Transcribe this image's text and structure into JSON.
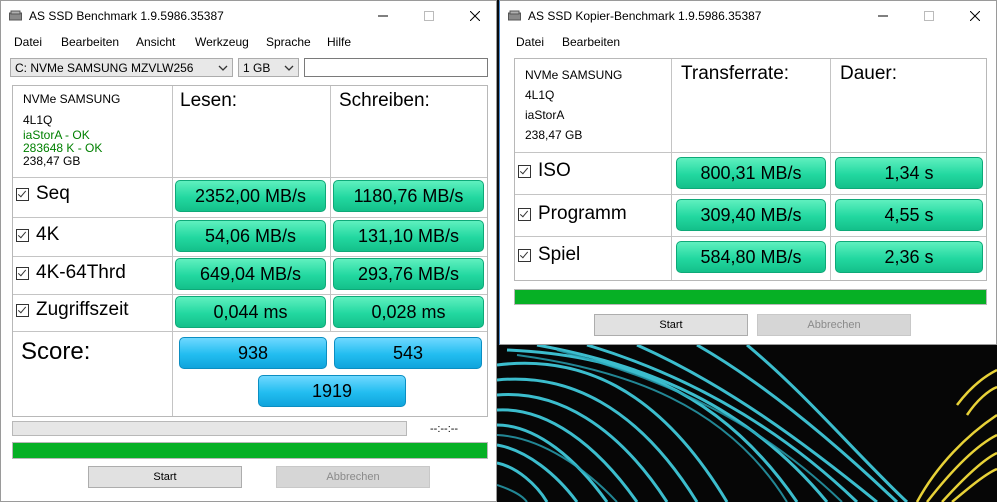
{
  "win1": {
    "title": "AS SSD Benchmark 1.9.5986.35387",
    "menu": [
      "Datei",
      "Bearbeiten",
      "Ansicht",
      "Werkzeug",
      "Sprache",
      "Hilfe"
    ],
    "drive_select": "C: NVMe SAMSUNG MZVLW256",
    "size_select": "1 GB",
    "info": {
      "model": "NVMe SAMSUNG",
      "firmware": "4L1Q",
      "driver": "iaStorA - OK",
      "alignment": "283648 K - OK",
      "capacity": "238,47 GB",
      "ok_color": "#008000"
    },
    "col_read": "Lesen:",
    "col_write": "Schreiben:",
    "rows": [
      {
        "label": "Seq",
        "read": "2352,00 MB/s",
        "write": "1180,76 MB/s"
      },
      {
        "label": "4K",
        "read": "54,06 MB/s",
        "write": "131,10 MB/s"
      },
      {
        "label": "4K-64Thrd",
        "read": "649,04 MB/s",
        "write": "293,76 MB/s"
      },
      {
        "label": "Zugriffszeit",
        "read": "0,044 ms",
        "write": "0,028 ms"
      }
    ],
    "score_label": "Score:",
    "score_read": "938",
    "score_write": "543",
    "score_total": "1919",
    "time_display": "--:--:--",
    "progress_top": 0,
    "progress_bottom": 1,
    "start": "Start",
    "cancel": "Abbrechen"
  },
  "win2": {
    "title": "AS SSD Kopier-Benchmark 1.9.5986.35387",
    "menu": [
      "Datei",
      "Bearbeiten"
    ],
    "info": {
      "model": "NVMe SAMSUNG",
      "firmware": "4L1Q",
      "driver": "iaStorA",
      "capacity": "238,47 GB"
    },
    "col_rate": "Transferrate:",
    "col_dur": "Dauer:",
    "rows": [
      {
        "label": "ISO",
        "rate": "800,31 MB/s",
        "dur": "1,34 s"
      },
      {
        "label": "Programm",
        "rate": "309,40 MB/s",
        "dur": "4,55 s"
      },
      {
        "label": "Spiel",
        "rate": "584,80 MB/s",
        "dur": "2,36 s"
      }
    ],
    "progress": 1,
    "start": "Start",
    "cancel": "Abbrechen"
  },
  "colors": {
    "result_green": "#22d8a0",
    "score_blue": "#22bdf0",
    "progress_green": "#06b025"
  },
  "icons": [
    "app-drive-icon",
    "minimize-icon",
    "maximize-icon",
    "close-icon",
    "checkbox-checked-icon",
    "dropdown-arrow-icon"
  ]
}
